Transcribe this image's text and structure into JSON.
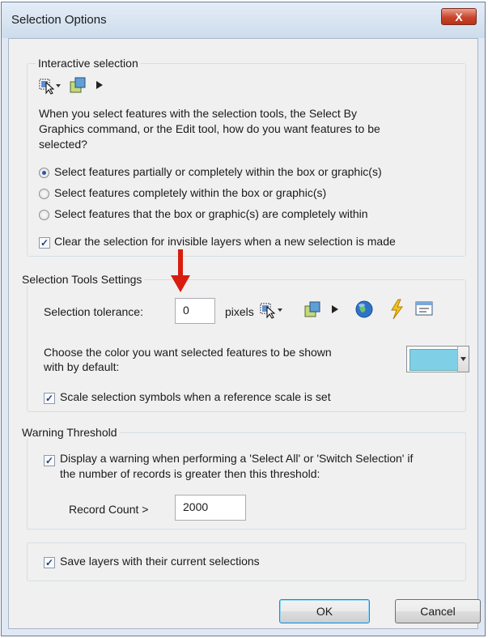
{
  "window": {
    "title": "Selection Options",
    "close_label": "X"
  },
  "interactive": {
    "legend": "Interactive selection",
    "question": [
      "When you select features with the selection tools, the Select By",
      "Graphics command, or the Edit tool, how do you want features to be",
      "selected?"
    ],
    "options": [
      {
        "label": "Select features partially or completely within the box or graphic(s)",
        "checked": true
      },
      {
        "label": "Select features completely within the box or graphic(s)",
        "checked": false
      },
      {
        "label": "Select features that the box or graphic(s) are completely within",
        "checked": false
      }
    ],
    "clear_label": "Clear the selection for invisible layers when a new selection is made",
    "clear_checked": true
  },
  "tools": {
    "legend": "Selection Tools Settings",
    "tolerance_label": "Selection tolerance:",
    "tolerance_value": "0",
    "pixels_label": "pixels",
    "color_question": [
      "Choose the color you want selected features to be shown",
      "with by default:"
    ],
    "color": "#7fd0e6",
    "scale_label": "Scale selection symbols when a reference scale is set",
    "scale_checked": true
  },
  "warning": {
    "legend": "Warning Threshold",
    "display_text": [
      "Display a warning when performing a 'Select All' or 'Switch Selection' if",
      "the number of records is greater then this threshold:"
    ],
    "display_checked": true,
    "record_label": "Record Count >",
    "record_value": "2000"
  },
  "save": {
    "label": "Save layers with their current selections",
    "checked": true
  },
  "buttons": {
    "ok": "OK",
    "cancel": "Cancel"
  },
  "colors": {
    "arrow": "#d81c10",
    "accent": "#2a57a8"
  }
}
